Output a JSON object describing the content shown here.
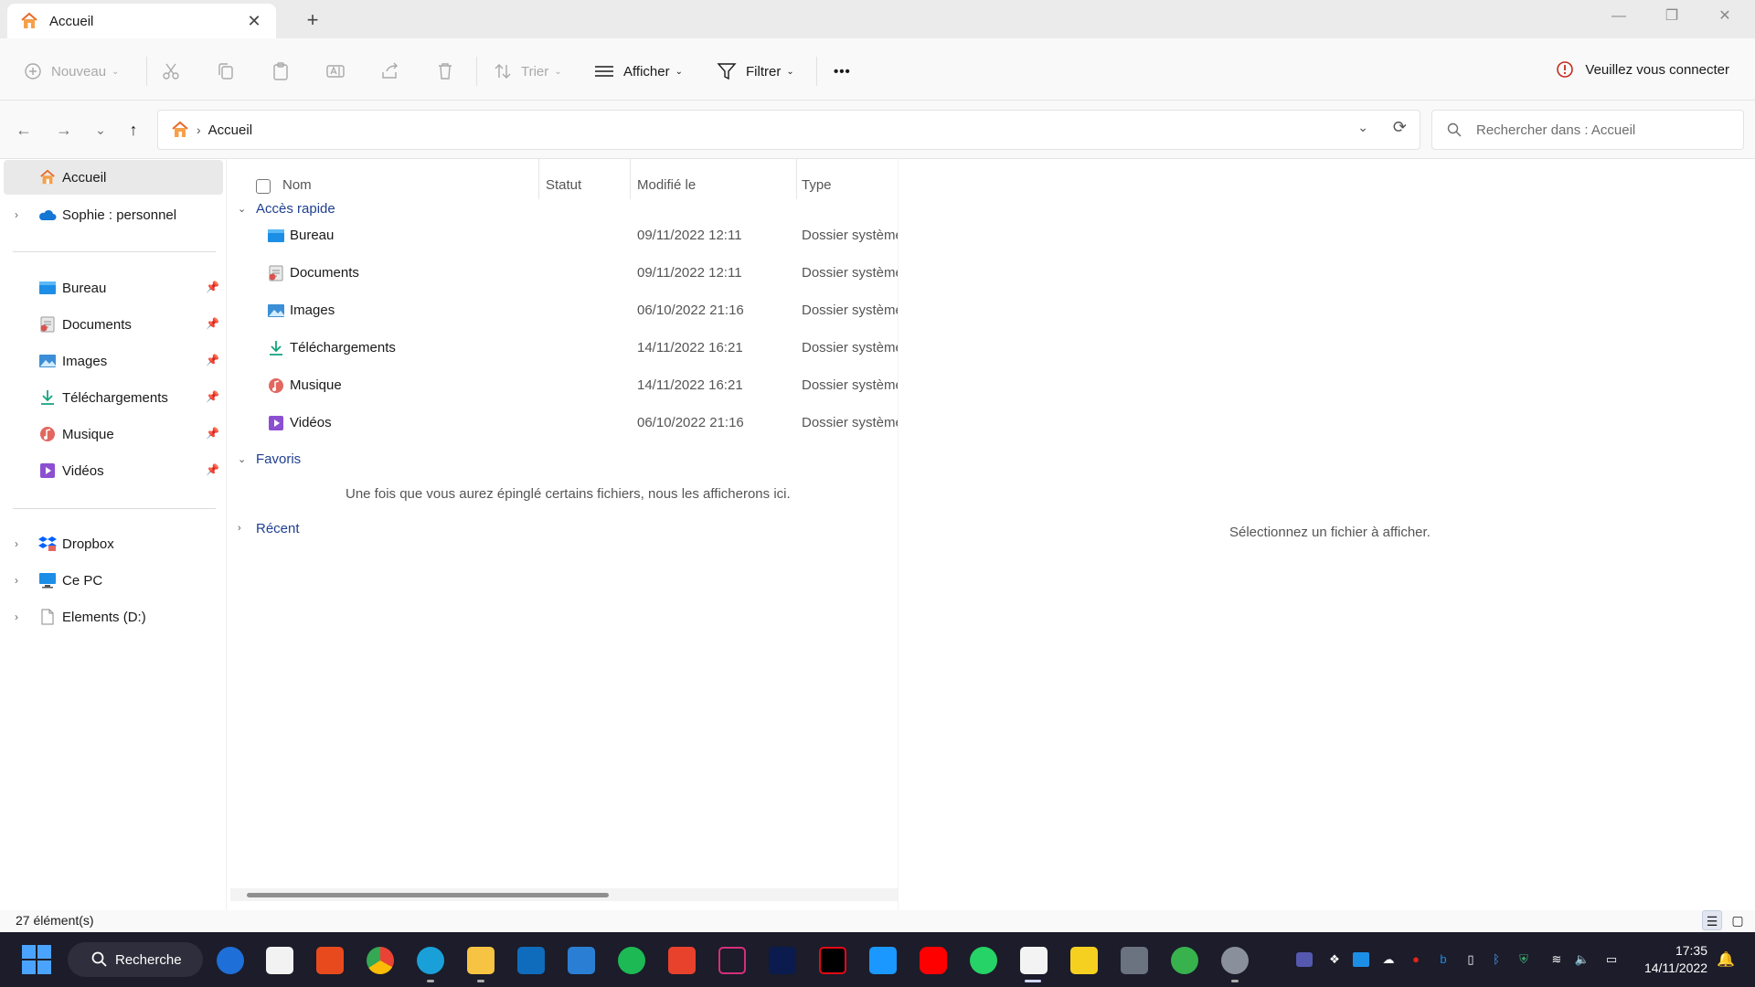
{
  "window": {
    "tab_title": "Accueil",
    "close_tab": "✕",
    "new_tab": "+",
    "minimize": "—",
    "maximize": "❐",
    "close": "✕"
  },
  "toolbar": {
    "new_label": "Nouveau",
    "sort_label": "Trier",
    "view_label": "Afficher",
    "filter_label": "Filtrer",
    "more_label": "•••",
    "connect_label": "Veuillez vous connecter"
  },
  "address": {
    "crumb": "Accueil",
    "separator": "›",
    "search_placeholder": "Rechercher dans : Accueil"
  },
  "sidebar": {
    "home": "Accueil",
    "onedrive": "Sophie : personnel",
    "pinned": [
      {
        "label": "Bureau",
        "icon": "desktop-folder-icon"
      },
      {
        "label": "Documents",
        "icon": "documents-folder-icon"
      },
      {
        "label": "Images",
        "icon": "pictures-folder-icon"
      },
      {
        "label": "Téléchargements",
        "icon": "downloads-folder-icon"
      },
      {
        "label": "Musique",
        "icon": "music-folder-icon"
      },
      {
        "label": "Vidéos",
        "icon": "videos-folder-icon"
      }
    ],
    "locations": [
      {
        "label": "Dropbox",
        "icon": "dropbox-icon"
      },
      {
        "label": "Ce PC",
        "icon": "this-pc-icon"
      },
      {
        "label": "Elements (D:)",
        "icon": "drive-icon"
      }
    ]
  },
  "content": {
    "columns": {
      "name": "Nom",
      "status": "Statut",
      "modified": "Modifié le",
      "type": "Type"
    },
    "groups": {
      "quick_access": "Accès rapide",
      "favorites": "Favoris",
      "recent": "Récent"
    },
    "quick_access_rows": [
      {
        "name": "Bureau",
        "date": "09/11/2022 12:11",
        "type": "Dossier système"
      },
      {
        "name": "Documents",
        "date": "09/11/2022 12:11",
        "type": "Dossier système"
      },
      {
        "name": "Images",
        "date": "06/10/2022 21:16",
        "type": "Dossier système"
      },
      {
        "name": "Téléchargements",
        "date": "14/11/2022 16:21",
        "type": "Dossier système"
      },
      {
        "name": "Musique",
        "date": "14/11/2022 16:21",
        "type": "Dossier système"
      },
      {
        "name": "Vidéos",
        "date": "06/10/2022 21:16",
        "type": "Dossier système"
      }
    ],
    "favorites_empty": "Une fois que vous aurez épinglé certains fichiers, nous les afficherons ici."
  },
  "preview": {
    "message": "Sélectionnez un fichier à afficher."
  },
  "status": {
    "count": "27 élément(s)"
  },
  "taskbar": {
    "search_label": "Recherche",
    "time": "17:35",
    "date": "14/11/2022"
  },
  "colors": {
    "accent": "#0067c0",
    "group_header": "#1f3f8f",
    "taskbar_bg": "#1c1c2a"
  }
}
